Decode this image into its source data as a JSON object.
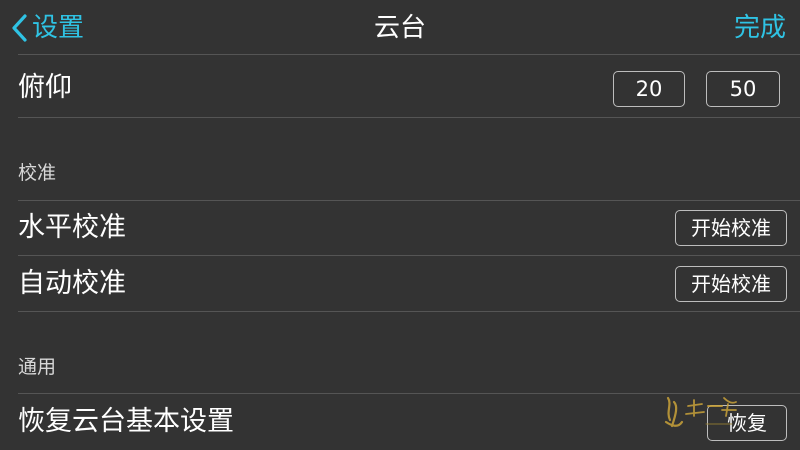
{
  "colors": {
    "background": "#333333",
    "accent": "#2fc3e4",
    "divider": "#555555",
    "text": "#ffffff",
    "section_text": "#d8d8d8"
  },
  "navbar": {
    "back_label": "设置",
    "title": "云台",
    "done_label": "完成"
  },
  "pitch": {
    "label": "俯仰",
    "value_1": "20",
    "value_2": "50"
  },
  "calibration": {
    "header": "校准",
    "horizontal_label": "水平校准",
    "horizontal_button": "开始校准",
    "auto_label": "自动校准",
    "auto_button": "开始校准"
  },
  "general": {
    "header": "通用",
    "reset_label": "恢复云台基本设置",
    "reset_button": "恢复"
  },
  "icons": {
    "back": "chevron-left-icon",
    "watermark": "calligraphy-watermark"
  }
}
